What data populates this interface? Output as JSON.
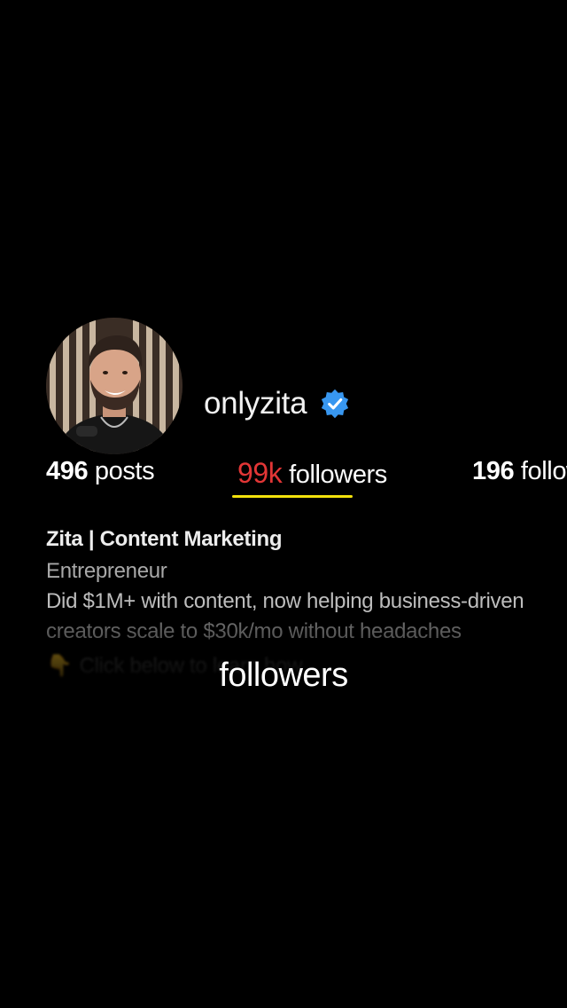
{
  "profile": {
    "username": "onlyzita",
    "verified_color": "#3897f0"
  },
  "stats": {
    "posts_count": "496",
    "posts_label": "posts",
    "followers_count": "99k",
    "followers_label": "followers",
    "following_count": "196",
    "following_label": "following"
  },
  "bio": {
    "name": "Zita | Content Marketing",
    "category": "Entrepreneur",
    "line1": "Did $1M+ with content, now helping business-driven",
    "line2": "creators scale to $30k/mo without headaches",
    "line3_emoji": "👇",
    "line3": "Click below to learn how"
  },
  "caption": {
    "text": "followers"
  },
  "colors": {
    "background": "#000000",
    "followers_highlight": "#e23636",
    "underline": "#f3e20c"
  }
}
